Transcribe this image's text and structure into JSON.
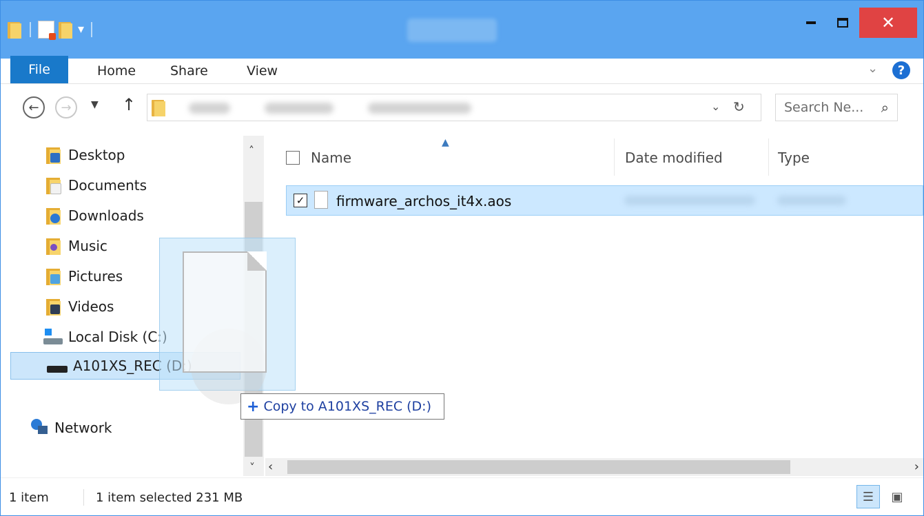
{
  "window": {
    "title": "",
    "accent": "#5aa5f0",
    "close_color": "#e04343"
  },
  "quick_access_toolbar": {
    "icons": [
      "folder-icon",
      "properties-icon",
      "new-folder-icon",
      "customize-dropdown-icon"
    ]
  },
  "ribbon": {
    "tabs": [
      "File",
      "Home",
      "Share",
      "View"
    ],
    "help": "?"
  },
  "address_bar": {
    "search_placeholder": "Search Ne..."
  },
  "nav_pane": {
    "items": [
      {
        "label": "Desktop",
        "icon": "desktop-folder-icon"
      },
      {
        "label": "Documents",
        "icon": "documents-folder-icon"
      },
      {
        "label": "Downloads",
        "icon": "downloads-folder-icon"
      },
      {
        "label": "Music",
        "icon": "music-folder-icon"
      },
      {
        "label": "Pictures",
        "icon": "pictures-folder-icon"
      },
      {
        "label": "Videos",
        "icon": "videos-folder-icon"
      },
      {
        "label": "Local Disk (C:)",
        "icon": "local-disk-icon"
      },
      {
        "label": "A101XS_REC (D:)",
        "icon": "removable-drive-icon"
      },
      {
        "label": "Network",
        "icon": "network-icon"
      }
    ]
  },
  "file_list": {
    "columns": [
      "Name",
      "Date modified",
      "Type"
    ],
    "rows": [
      {
        "name": "firmware_archos_it4x.aos",
        "checked": true,
        "selected": true
      }
    ]
  },
  "drag": {
    "tooltip": "Copy to A101XS_REC (D:)",
    "tooltip_icon": "plus-icon"
  },
  "status_bar": {
    "item_count": "1 item",
    "selection": "1 item selected  231 MB"
  }
}
